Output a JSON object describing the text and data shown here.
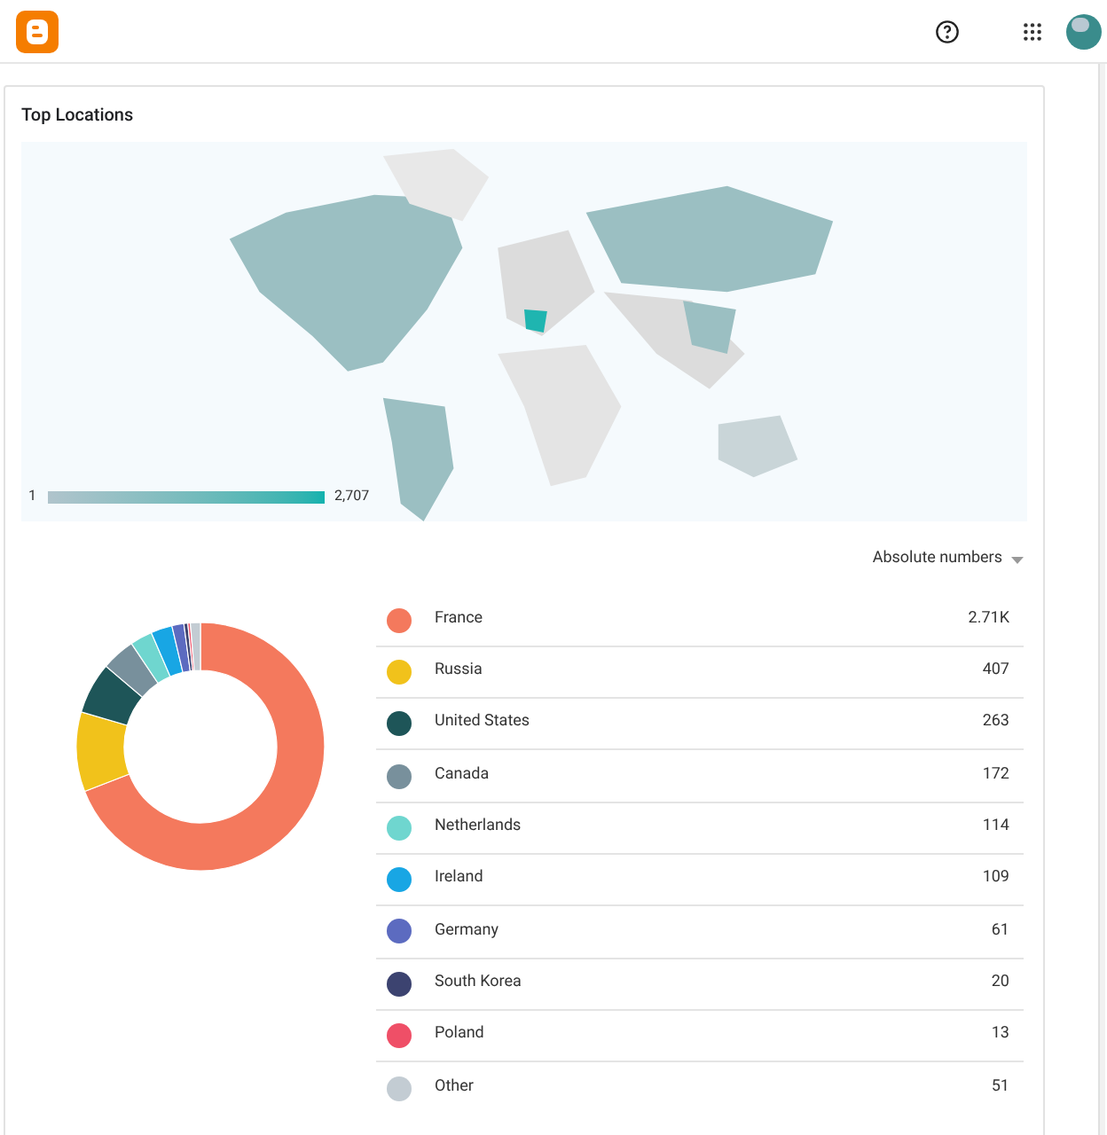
{
  "card": {
    "title": "Top Locations"
  },
  "map": {
    "kind": "picture",
    "scale_min": "1",
    "scale_max": "2,707"
  },
  "dropdown": {
    "label": "Absolute numbers"
  },
  "chart_data": {
    "type": "donut",
    "categories": [
      "France",
      "Russia",
      "United States",
      "Canada",
      "Netherlands",
      "Ireland",
      "Germany",
      "South Korea",
      "Poland",
      "Other"
    ],
    "values": [
      69.13,
      10.38,
      6.71,
      4.39,
      2.91,
      2.78,
      1.56,
      0.51,
      0.33,
      1.3
    ]
  },
  "legend": [
    {
      "value": "2.71K",
      "color": "#f4795d"
    },
    {
      "value": "407",
      "color": "#f1c21b"
    },
    {
      "value": "263",
      "color": "#1e5558"
    },
    {
      "value": "172",
      "color": "#78909c"
    },
    {
      "value": "114",
      "color": "#6fd6cf"
    },
    {
      "value": "109",
      "color": "#18a6e4"
    },
    {
      "value": "61",
      "color": "#5c6bc0"
    },
    {
      "value": "20",
      "color": "#3c4370"
    },
    {
      "value": "13",
      "color": "#ef4f67"
    },
    {
      "value": "51",
      "color": "#c3ccd3"
    }
  ]
}
